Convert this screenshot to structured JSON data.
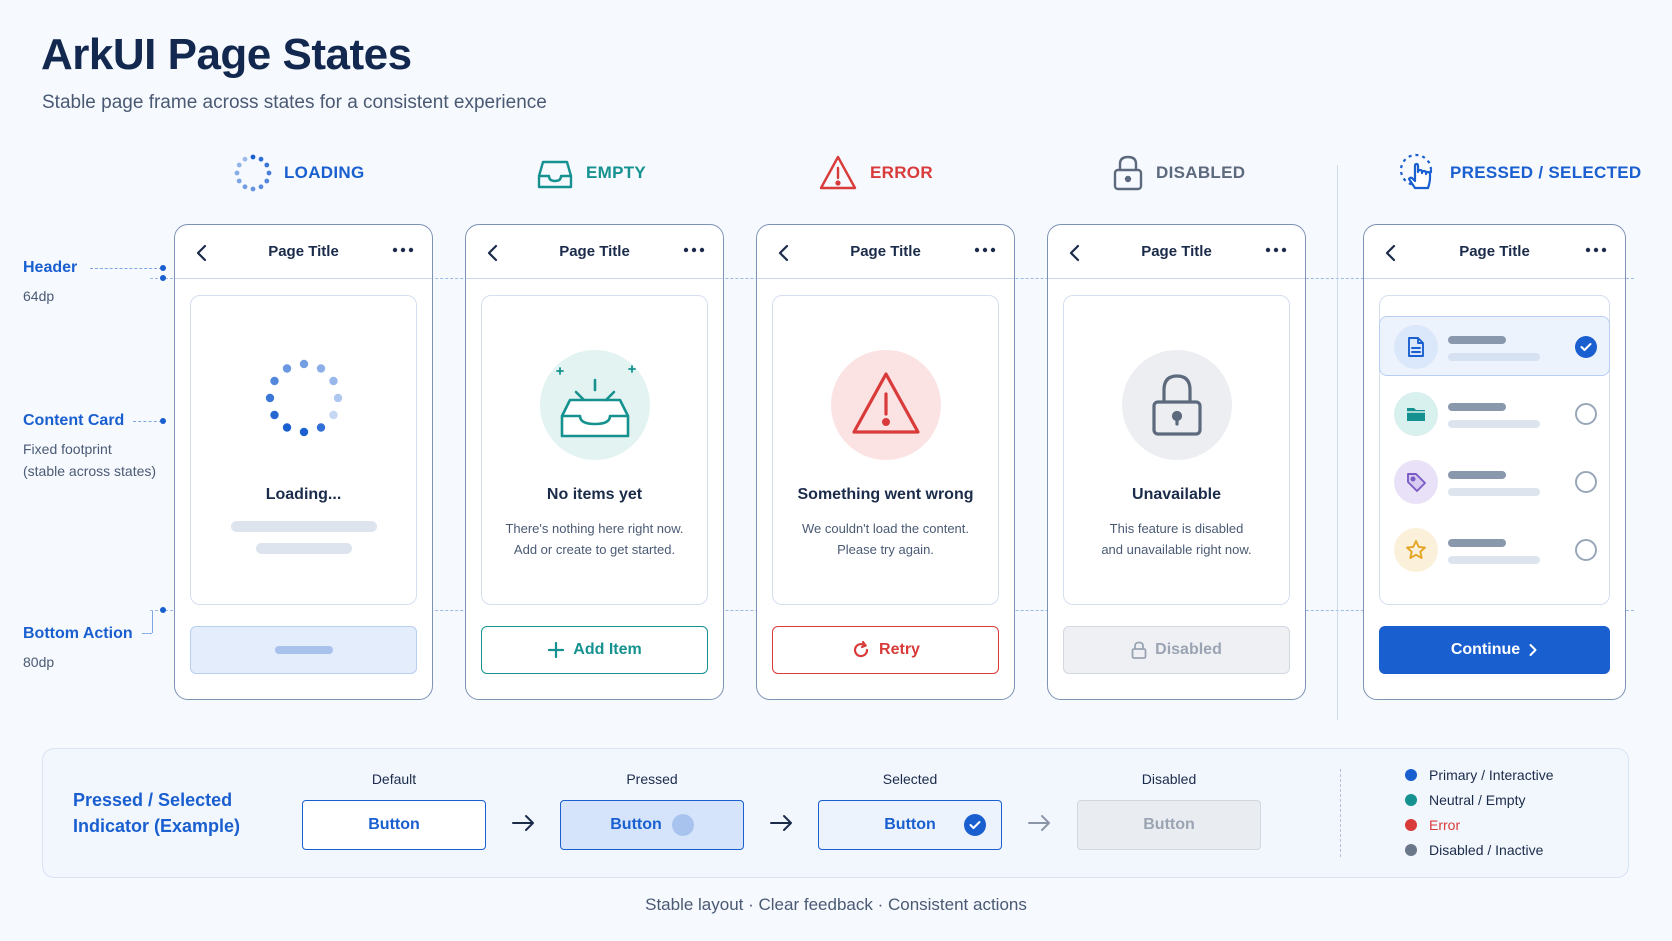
{
  "title": "ArkUI Page States",
  "subtitle": "Stable page frame across states for a consistent experience",
  "annotations": {
    "header": {
      "label": "Header",
      "sub": "64dp"
    },
    "content": {
      "label": "Content Card",
      "sub1": "Fixed footprint",
      "sub2": "(stable across states)"
    },
    "bottom": {
      "label": "Bottom Action",
      "sub": "80dp"
    }
  },
  "states": [
    {
      "label": "LOADING",
      "color": "#1a5fd0",
      "icon": "loading-spinner-icon",
      "page_title": "Page Title",
      "card_title": "Loading...",
      "message1": "",
      "message2": "",
      "action": ""
    },
    {
      "label": "EMPTY",
      "color": "#15928f",
      "icon": "inbox-tray-icon",
      "page_title": "Page Title",
      "card_title": "No items yet",
      "message1": "There's nothing here right now.",
      "message2": "Add or create to get started.",
      "action": "Add Item"
    },
    {
      "label": "ERROR",
      "color": "#d93a3a",
      "icon": "warning-triangle-icon",
      "page_title": "Page Title",
      "card_title": "Something went wrong",
      "message1": "We couldn't load the content.",
      "message2": "Please try again.",
      "action": "Retry"
    },
    {
      "label": "DISABLED",
      "color": "#5d6a7e",
      "icon": "lock-icon",
      "page_title": "Page Title",
      "card_title": "Unavailable",
      "message1": "This feature is disabled",
      "message2": "and unavailable right now.",
      "action": "Disabled"
    },
    {
      "label": "PRESSED / SELECTED",
      "color": "#1a5fd0",
      "icon": "tap-pointer-icon",
      "page_title": "Page Title",
      "action": "Continue"
    }
  ],
  "selection_list": [
    {
      "icon": "document-icon",
      "bg": "#dbe8fb",
      "fg": "#1a5fd0",
      "selected": true
    },
    {
      "icon": "folder-icon",
      "bg": "#d8f0ee",
      "fg": "#15928f",
      "selected": false
    },
    {
      "icon": "tag-icon",
      "bg": "#e9e1f7",
      "fg": "#7b5cc4",
      "selected": false
    },
    {
      "icon": "star-icon",
      "bg": "#fbf0d9",
      "fg": "#e5a525",
      "selected": false
    }
  ],
  "indicator": {
    "title1": "Pressed / Selected",
    "title2": "Indicator (Example)",
    "states": [
      {
        "label": "Default",
        "button": "Button"
      },
      {
        "label": "Pressed",
        "button": "Button"
      },
      {
        "label": "Selected",
        "button": "Button"
      },
      {
        "label": "Disabled",
        "button": "Button"
      }
    ]
  },
  "legend": [
    {
      "label": "Primary / Interactive",
      "color": "#1a5fd0"
    },
    {
      "label": "Neutral / Empty",
      "color": "#15928f"
    },
    {
      "label": "Error",
      "color": "#d93a3a"
    },
    {
      "label": "Disabled / Inactive",
      "color": "#6b778a"
    }
  ],
  "footer": "Stable layout · Clear feedback · Consistent actions"
}
